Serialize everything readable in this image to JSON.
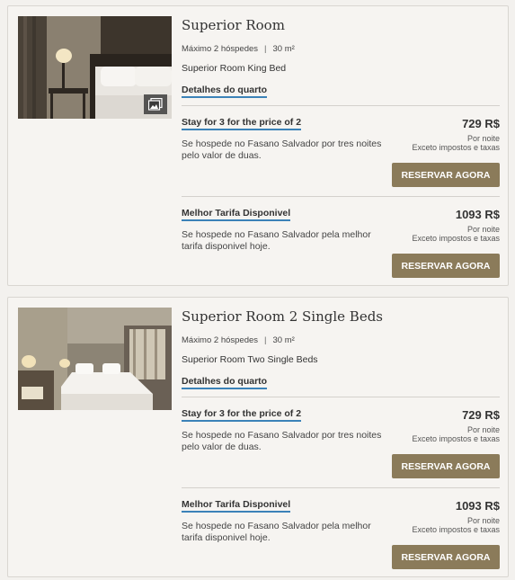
{
  "rooms": [
    {
      "title": "Superior Room",
      "max_guests": "Máximo 2 hóspedes",
      "separator": "|",
      "area": "30 m²",
      "bed": "Superior Room King Bed",
      "details_link": "Detalhes do quarto",
      "thumbnail_icon": "gallery-icon",
      "rates": [
        {
          "name": "Stay for 3 for the price of 2",
          "description": "Se hospede no Fasano Salvador por tres noites pelo valor de duas.",
          "price": "729 R$",
          "per_night": "Por noite",
          "taxes": "Exceto impostos e taxas",
          "button": "RESERVAR AGORA"
        },
        {
          "name": "Melhor Tarifa Disponivel",
          "description": "Se hospede no Fasano Salvador pela melhor tarifa disponivel hoje.",
          "price": "1093 R$",
          "per_night": "Por noite",
          "taxes": "Exceto impostos e taxas",
          "button": "RESERVAR AGORA"
        }
      ]
    },
    {
      "title": "Superior Room 2 Single Beds",
      "max_guests": "Máximo 2 hóspedes",
      "separator": "|",
      "area": "30 m²",
      "bed": "Superior Room Two Single Beds",
      "details_link": "Detalhes do quarto",
      "rates": [
        {
          "name": "Stay for 3 for the price of 2",
          "description": "Se hospede no Fasano Salvador por tres noites pelo valor de duas.",
          "price": "729 R$",
          "per_night": "Por noite",
          "taxes": "Exceto impostos e taxas",
          "button": "RESERVAR AGORA"
        },
        {
          "name": "Melhor Tarifa Disponivel",
          "description": "Se hospede no Fasano Salvador pela melhor tarifa disponivel hoje.",
          "price": "1093 R$",
          "per_night": "Por noite",
          "taxes": "Exceto impostos e taxas",
          "button": "RESERVAR AGORA"
        }
      ]
    }
  ],
  "colors": {
    "accent_button": "#8b7b5a",
    "link_underline": "#3b82b8",
    "card_bg": "#f6f4f1"
  }
}
